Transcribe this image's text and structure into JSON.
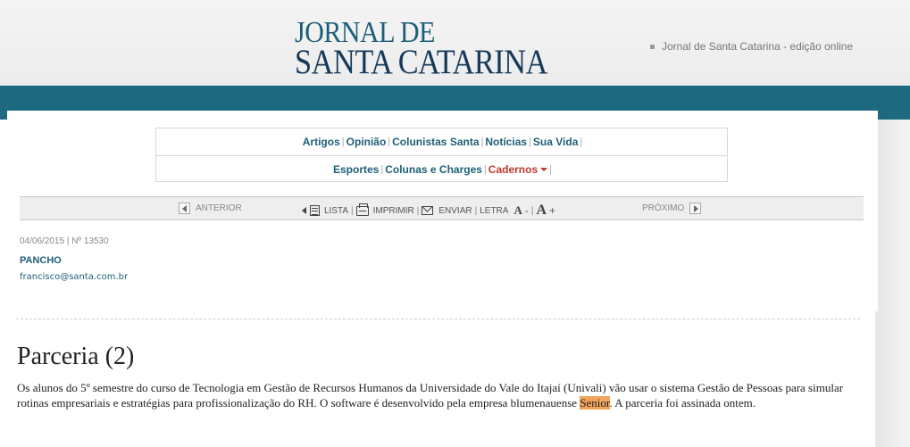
{
  "header": {
    "logo_line1": "JORNAL DE",
    "logo_line2": "SANTA CATARINA",
    "edition_link": "Jornal de Santa Catarina - edição online"
  },
  "nav": {
    "row1": [
      "Artigos",
      "Opinião",
      "Colunistas Santa",
      "Notícias",
      "Sua Vida"
    ],
    "row2": [
      "Esportes",
      "Colunas e Charges",
      "Cadernos"
    ]
  },
  "toolbar": {
    "prev_label": "ANTERIOR",
    "list_label": "LISTA",
    "print_label": "IMPRIMIR",
    "send_label": "ENVIAR",
    "font_label": "LETRA",
    "font_small": "A",
    "font_minus": "-",
    "font_large": "A",
    "font_plus": "+",
    "next_label": "PRÓXIMO"
  },
  "article": {
    "date_edition": "04/06/2015 | Nº 13530",
    "author": "PANCHO",
    "email": "francisco@santa.com.br",
    "title": "Parceria (2)",
    "body_before": "Os alunos do 5º semestre do curso de Tecnologia em Gestão de Recursos Humanos da Universidade do Vale do Itajaí (Univali) vão usar o sistema Gestão de Pessoas para simular rotinas empresariais e estratégias para profissionalização do RH. O software é desenvolvido pela empresa blumenauense ",
    "body_highlight": "Senior",
    "body_after": ". A parceria foi assinada ontem."
  },
  "colors": {
    "brand_teal": "#1d6a80",
    "link_teal": "#1d5f78",
    "accent_red": "#c0392b",
    "highlight": "#f2a45a"
  }
}
